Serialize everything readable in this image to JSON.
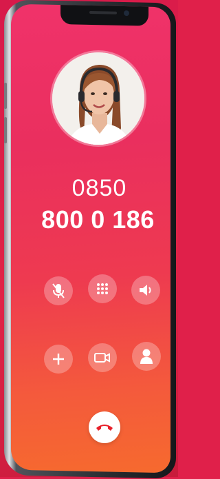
{
  "call": {
    "number_line1": "0850",
    "number_line2": "800 0 186"
  },
  "controls": [
    {
      "icon": "mic-off-icon"
    },
    {
      "icon": "keypad-icon"
    },
    {
      "icon": "speaker-icon"
    },
    {
      "icon": "add-call-icon"
    },
    {
      "icon": "video-icon"
    },
    {
      "icon": "contacts-icon"
    }
  ],
  "end_call": {
    "icon": "phone-hangup-icon",
    "color": "#e8202a"
  },
  "colors": {
    "screen_top": "#f0326a",
    "screen_bottom": "#f66a2e",
    "frame": "#2a2c31"
  }
}
